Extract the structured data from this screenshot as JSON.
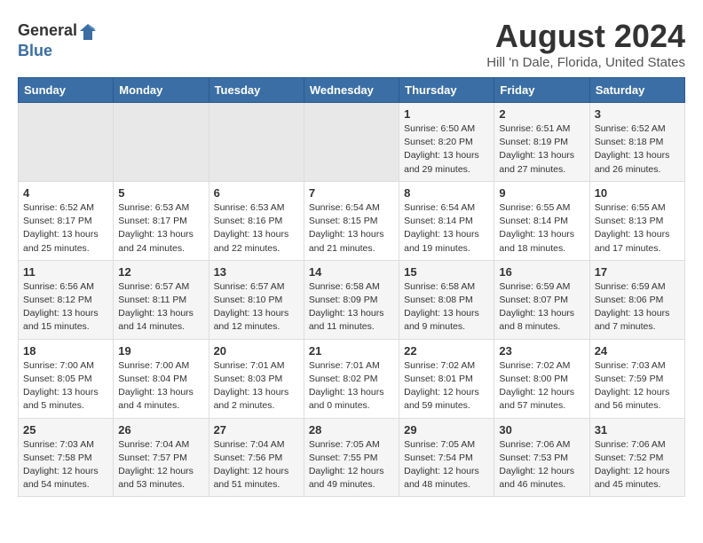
{
  "logo": {
    "general": "General",
    "blue": "Blue"
  },
  "header": {
    "title": "August 2024",
    "subtitle": "Hill 'n Dale, Florida, United States"
  },
  "days_of_week": [
    "Sunday",
    "Monday",
    "Tuesday",
    "Wednesday",
    "Thursday",
    "Friday",
    "Saturday"
  ],
  "weeks": [
    {
      "days": [
        {
          "num": "",
          "data": ""
        },
        {
          "num": "",
          "data": ""
        },
        {
          "num": "",
          "data": ""
        },
        {
          "num": "",
          "data": ""
        },
        {
          "num": "1",
          "data": "Sunrise: 6:50 AM\nSunset: 8:20 PM\nDaylight: 13 hours\nand 29 minutes."
        },
        {
          "num": "2",
          "data": "Sunrise: 6:51 AM\nSunset: 8:19 PM\nDaylight: 13 hours\nand 27 minutes."
        },
        {
          "num": "3",
          "data": "Sunrise: 6:52 AM\nSunset: 8:18 PM\nDaylight: 13 hours\nand 26 minutes."
        }
      ]
    },
    {
      "days": [
        {
          "num": "4",
          "data": "Sunrise: 6:52 AM\nSunset: 8:17 PM\nDaylight: 13 hours\nand 25 minutes."
        },
        {
          "num": "5",
          "data": "Sunrise: 6:53 AM\nSunset: 8:17 PM\nDaylight: 13 hours\nand 24 minutes."
        },
        {
          "num": "6",
          "data": "Sunrise: 6:53 AM\nSunset: 8:16 PM\nDaylight: 13 hours\nand 22 minutes."
        },
        {
          "num": "7",
          "data": "Sunrise: 6:54 AM\nSunset: 8:15 PM\nDaylight: 13 hours\nand 21 minutes."
        },
        {
          "num": "8",
          "data": "Sunrise: 6:54 AM\nSunset: 8:14 PM\nDaylight: 13 hours\nand 19 minutes."
        },
        {
          "num": "9",
          "data": "Sunrise: 6:55 AM\nSunset: 8:14 PM\nDaylight: 13 hours\nand 18 minutes."
        },
        {
          "num": "10",
          "data": "Sunrise: 6:55 AM\nSunset: 8:13 PM\nDaylight: 13 hours\nand 17 minutes."
        }
      ]
    },
    {
      "days": [
        {
          "num": "11",
          "data": "Sunrise: 6:56 AM\nSunset: 8:12 PM\nDaylight: 13 hours\nand 15 minutes."
        },
        {
          "num": "12",
          "data": "Sunrise: 6:57 AM\nSunset: 8:11 PM\nDaylight: 13 hours\nand 14 minutes."
        },
        {
          "num": "13",
          "data": "Sunrise: 6:57 AM\nSunset: 8:10 PM\nDaylight: 13 hours\nand 12 minutes."
        },
        {
          "num": "14",
          "data": "Sunrise: 6:58 AM\nSunset: 8:09 PM\nDaylight: 13 hours\nand 11 minutes."
        },
        {
          "num": "15",
          "data": "Sunrise: 6:58 AM\nSunset: 8:08 PM\nDaylight: 13 hours\nand 9 minutes."
        },
        {
          "num": "16",
          "data": "Sunrise: 6:59 AM\nSunset: 8:07 PM\nDaylight: 13 hours\nand 8 minutes."
        },
        {
          "num": "17",
          "data": "Sunrise: 6:59 AM\nSunset: 8:06 PM\nDaylight: 13 hours\nand 7 minutes."
        }
      ]
    },
    {
      "days": [
        {
          "num": "18",
          "data": "Sunrise: 7:00 AM\nSunset: 8:05 PM\nDaylight: 13 hours\nand 5 minutes."
        },
        {
          "num": "19",
          "data": "Sunrise: 7:00 AM\nSunset: 8:04 PM\nDaylight: 13 hours\nand 4 minutes."
        },
        {
          "num": "20",
          "data": "Sunrise: 7:01 AM\nSunset: 8:03 PM\nDaylight: 13 hours\nand 2 minutes."
        },
        {
          "num": "21",
          "data": "Sunrise: 7:01 AM\nSunset: 8:02 PM\nDaylight: 13 hours\nand 0 minutes."
        },
        {
          "num": "22",
          "data": "Sunrise: 7:02 AM\nSunset: 8:01 PM\nDaylight: 12 hours\nand 59 minutes."
        },
        {
          "num": "23",
          "data": "Sunrise: 7:02 AM\nSunset: 8:00 PM\nDaylight: 12 hours\nand 57 minutes."
        },
        {
          "num": "24",
          "data": "Sunrise: 7:03 AM\nSunset: 7:59 PM\nDaylight: 12 hours\nand 56 minutes."
        }
      ]
    },
    {
      "days": [
        {
          "num": "25",
          "data": "Sunrise: 7:03 AM\nSunset: 7:58 PM\nDaylight: 12 hours\nand 54 minutes."
        },
        {
          "num": "26",
          "data": "Sunrise: 7:04 AM\nSunset: 7:57 PM\nDaylight: 12 hours\nand 53 minutes."
        },
        {
          "num": "27",
          "data": "Sunrise: 7:04 AM\nSunset: 7:56 PM\nDaylight: 12 hours\nand 51 minutes."
        },
        {
          "num": "28",
          "data": "Sunrise: 7:05 AM\nSunset: 7:55 PM\nDaylight: 12 hours\nand 49 minutes."
        },
        {
          "num": "29",
          "data": "Sunrise: 7:05 AM\nSunset: 7:54 PM\nDaylight: 12 hours\nand 48 minutes."
        },
        {
          "num": "30",
          "data": "Sunrise: 7:06 AM\nSunset: 7:53 PM\nDaylight: 12 hours\nand 46 minutes."
        },
        {
          "num": "31",
          "data": "Sunrise: 7:06 AM\nSunset: 7:52 PM\nDaylight: 12 hours\nand 45 minutes."
        }
      ]
    }
  ]
}
